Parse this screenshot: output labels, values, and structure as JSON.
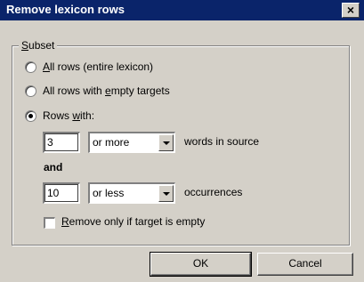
{
  "window": {
    "title": "Remove lexicon rows",
    "close_glyph": "×"
  },
  "subset": {
    "legend_prefix": "S",
    "legend_rest": "ubset",
    "options": [
      {
        "u": "A",
        "rest": "ll rows (entire lexicon)",
        "pre": "",
        "checked": false
      },
      {
        "pre": "All rows with ",
        "u": "e",
        "rest": "mpty targets",
        "checked": false
      },
      {
        "pre": "Rows ",
        "u": "w",
        "rest": "ith:",
        "checked": true
      }
    ]
  },
  "criteria": {
    "words": {
      "value": "3",
      "comparator": "or more",
      "unit": "words in source"
    },
    "joiner": "and",
    "occurrences": {
      "value": "10",
      "comparator": "or less",
      "unit": "occurrences"
    }
  },
  "empty_target_check": {
    "u": "R",
    "rest": "emove only if target is empty",
    "checked": false
  },
  "buttons": {
    "ok": "OK",
    "cancel": "Cancel"
  }
}
